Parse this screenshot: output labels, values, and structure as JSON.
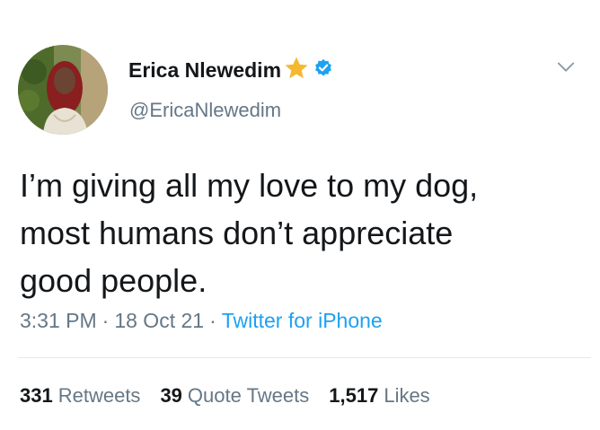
{
  "author": {
    "display_name": "Erica Nlewedim",
    "handle": "@EricaNlewedim",
    "star_icon": "star-icon",
    "verified_icon": "verified-badge-icon",
    "verified_color": "#1da1f2"
  },
  "tweet": {
    "text": "I’m giving all my love to my dog,\nmost humans don’t appreciate\ngood people.",
    "time": "3:31 PM",
    "date": "18 Oct 21",
    "source": "Twitter for iPhone",
    "separator": "·"
  },
  "stats": {
    "retweets_count": "331",
    "retweets_label": "Retweets",
    "quotes_count": "39",
    "quotes_label": "Quote Tweets",
    "likes_count": "1,517",
    "likes_label": "Likes"
  },
  "colors": {
    "link": "#1da1f2",
    "secondary_text": "#657786",
    "primary_text": "#14171a"
  }
}
